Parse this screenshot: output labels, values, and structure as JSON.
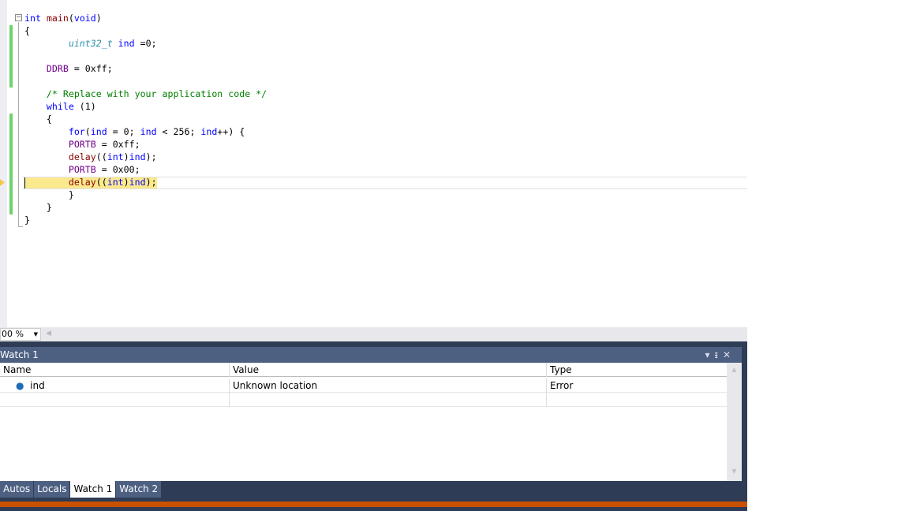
{
  "editor": {
    "lines": [
      [
        [
          "kw",
          "int"
        ],
        [
          "tx",
          " "
        ],
        [
          "fn",
          "main"
        ],
        [
          "tx",
          "("
        ],
        [
          "kw",
          "void"
        ],
        [
          "tx",
          ")"
        ]
      ],
      [
        [
          "tx",
          "{"
        ]
      ],
      [
        [
          "tx",
          "        "
        ],
        [
          "ty",
          "uint32_t"
        ],
        [
          "tx",
          " "
        ],
        [
          "kw",
          "ind"
        ],
        [
          "tx",
          " =0;"
        ]
      ],
      [],
      [
        [
          "tx",
          "    "
        ],
        [
          "mac",
          "DDRB"
        ],
        [
          "tx",
          " = 0xff;"
        ]
      ],
      [],
      [
        [
          "tx",
          "    "
        ],
        [
          "cm",
          "/* Replace with your application code */"
        ]
      ],
      [
        [
          "tx",
          "    "
        ],
        [
          "kw",
          "while"
        ],
        [
          "tx",
          " (1)"
        ]
      ],
      [
        [
          "tx",
          "    {"
        ]
      ],
      [
        [
          "tx",
          "        "
        ],
        [
          "kw",
          "for"
        ],
        [
          "tx",
          "("
        ],
        [
          "kw",
          "ind"
        ],
        [
          "tx",
          " = 0; "
        ],
        [
          "kw",
          "ind"
        ],
        [
          "tx",
          " < 256; "
        ],
        [
          "kw",
          "ind"
        ],
        [
          "tx",
          "++) {"
        ]
      ],
      [
        [
          "tx",
          "        "
        ],
        [
          "mac",
          "PORTB"
        ],
        [
          "tx",
          " = 0xff;"
        ]
      ],
      [
        [
          "tx",
          "        "
        ],
        [
          "fn",
          "delay"
        ],
        [
          "tx",
          "(("
        ],
        [
          "kw",
          "int"
        ],
        [
          "tx",
          ")"
        ],
        [
          "kw",
          "ind"
        ],
        [
          "tx",
          ");"
        ]
      ],
      [
        [
          "tx",
          "        "
        ],
        [
          "mac",
          "PORTB"
        ],
        [
          "tx",
          " = 0x00;"
        ]
      ],
      [
        [
          "tx",
          "        "
        ],
        [
          "fn",
          "delay"
        ],
        [
          "tx",
          "(("
        ],
        [
          "kw",
          "int"
        ],
        [
          "tx",
          ")"
        ],
        [
          "kw",
          "ind"
        ],
        [
          "tx",
          ");"
        ]
      ],
      [
        [
          "tx",
          "        }"
        ]
      ],
      [
        [
          "tx",
          "    }"
        ]
      ],
      [
        [
          "tx",
          "}"
        ]
      ]
    ],
    "zoom": "00 %"
  },
  "watch": {
    "title": "Watch 1",
    "columns": [
      "Name",
      "Value",
      "Type"
    ],
    "rows": [
      {
        "name": "ind",
        "value": "Unknown location",
        "type": "Error"
      }
    ]
  },
  "tabs": [
    "Autos",
    "Locals",
    "Watch 1",
    "Watch 2"
  ],
  "colors": {
    "accent": "#ca5100",
    "panel": "#4d6082",
    "highlight": "#fbe98e"
  }
}
